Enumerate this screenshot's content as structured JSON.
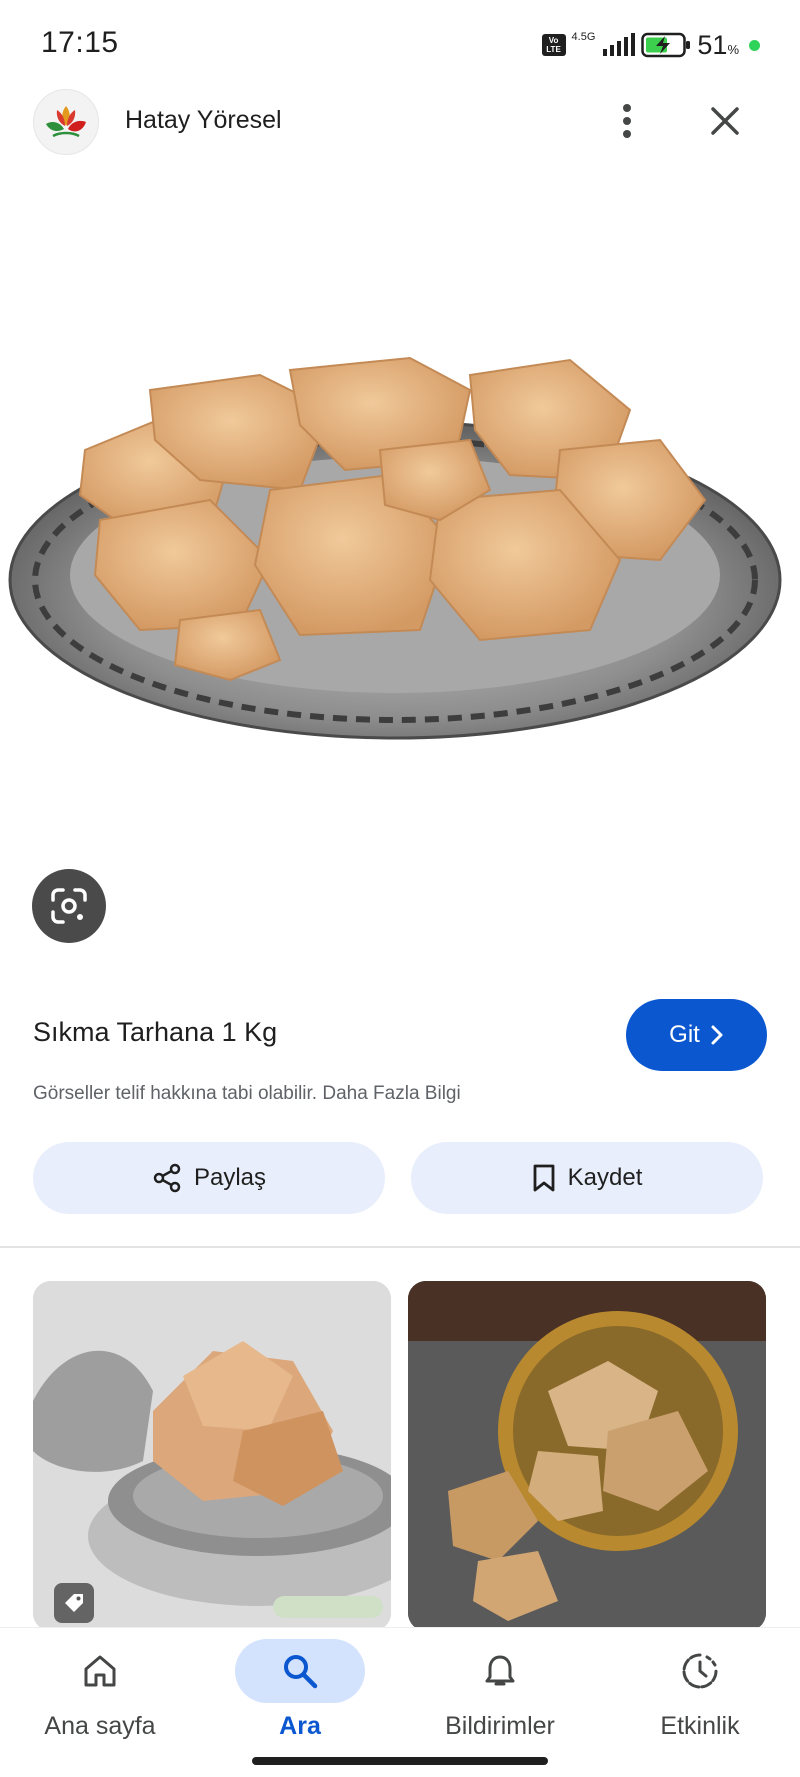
{
  "status_bar": {
    "time": "17:15",
    "network": "4.5G",
    "volte": "Vo LTE",
    "battery_percent": "51",
    "battery_unit": "%",
    "icons": [
      "volte-icon",
      "signal-icon",
      "battery-charging-icon"
    ]
  },
  "header": {
    "site_name": "Hatay Yöresel",
    "icons": [
      "site-logo",
      "more-vert-icon",
      "close-icon"
    ]
  },
  "product": {
    "title": "Sıkma Tarhana 1 Kg",
    "go_label": "Git",
    "copyright_text": "Görseller telif hakkına tabi olabilir. Daha Fazla Bilgi"
  },
  "actions": {
    "share_label": "Paylaş",
    "save_label": "Kaydet"
  },
  "bottom_nav": {
    "items": [
      {
        "label": "Ana sayfa",
        "icon": "home-icon",
        "active": false
      },
      {
        "label": "Ara",
        "icon": "search-icon",
        "active": true
      },
      {
        "label": "Bildirimler",
        "icon": "bell-icon",
        "active": false
      },
      {
        "label": "Etkinlik",
        "icon": "activity-icon",
        "active": false
      }
    ]
  },
  "colors": {
    "accent": "#0b57d0",
    "action_bg": "#e8eefb",
    "nav_active_bg": "#d3e3fd"
  }
}
